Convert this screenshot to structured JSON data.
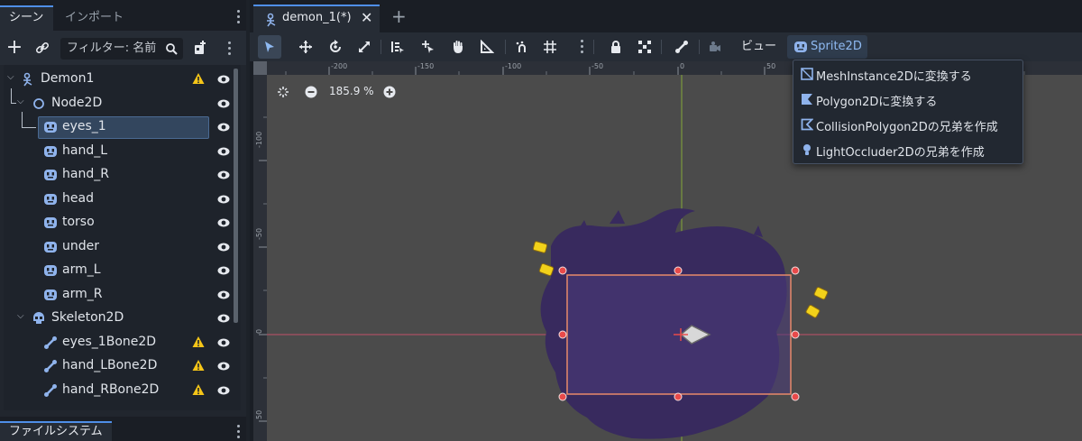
{
  "left_dock": {
    "tabs": [
      {
        "label": "シーン"
      },
      {
        "label": "インポート"
      }
    ],
    "filter_placeholder": "フィルター: 名前",
    "tree": [
      {
        "label": "Demon1",
        "warning": true
      },
      {
        "label": "Node2D",
        "warning": false
      },
      {
        "label": "eyes_1",
        "warning": false,
        "selected": true
      },
      {
        "label": "hand_L",
        "warning": false
      },
      {
        "label": "hand_R",
        "warning": false
      },
      {
        "label": "head",
        "warning": false
      },
      {
        "label": "torso",
        "warning": false
      },
      {
        "label": "under",
        "warning": false
      },
      {
        "label": "arm_L",
        "warning": false
      },
      {
        "label": "arm_R",
        "warning": false
      },
      {
        "label": "Skeleton2D",
        "warning": false
      },
      {
        "label": "eyes_1Bone2D",
        "warning": true
      },
      {
        "label": "hand_LBone2D",
        "warning": true
      },
      {
        "label": "hand_RBone2D",
        "warning": true
      }
    ],
    "filesystem_tab": "ファイルシステム"
  },
  "editor": {
    "scene_tab": "demon_1(*)",
    "view_menu": "ビュー",
    "sprite_menu": "Sprite2D",
    "zoom": "185.9 %",
    "ruler_h": [
      "-200",
      "-150",
      "-100",
      "-50",
      "0",
      "50"
    ],
    "ruler_v": [
      "-100",
      "-50",
      "0",
      "50"
    ]
  },
  "dropdown": {
    "items": [
      {
        "label": "MeshInstance2Dに変換する",
        "icon": "mesh-instance-icon"
      },
      {
        "label": "Polygon2Dに変換する",
        "icon": "polygon-icon"
      },
      {
        "label": "CollisionPolygon2Dの兄弟を作成",
        "icon": "collision-polygon-icon"
      },
      {
        "label": "LightOccluder2Dの兄弟を作成",
        "icon": "light-occluder-icon"
      }
    ]
  },
  "colors": {
    "accent": "#4f8fe8",
    "selection": "#33465e",
    "viewport_bg": "#4b4b4b",
    "sprite_purple": "#382a5e",
    "rect_outline": "#e8896a",
    "handle": "#e84a4a",
    "warning": "#f5c518",
    "x_axis": "#c0506a",
    "y_axis": "#86a83a"
  }
}
